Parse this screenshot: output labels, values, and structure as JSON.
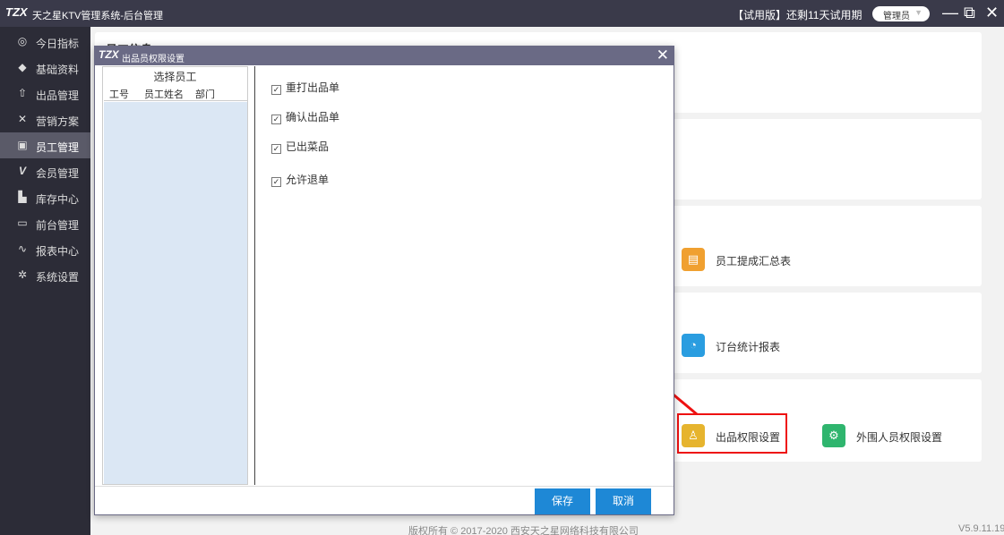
{
  "titlebar": {
    "logo": "TZX",
    "title": "天之星KTV管理系统-后台管理",
    "trial": "【试用版】还剩11天试用期",
    "role": "管理员",
    "role_chevron": "▼",
    "minimize": "—",
    "restore": "⧉",
    "close": "✕"
  },
  "sidebar": {
    "items": [
      {
        "label": "今日指标",
        "icon": "target-icon",
        "glyph": "◎"
      },
      {
        "label": "基础资料",
        "icon": "layers-icon",
        "glyph": "◆"
      },
      {
        "label": "出品管理",
        "icon": "upload-icon",
        "glyph": "⇧"
      },
      {
        "label": "营销方案",
        "icon": "tools-icon",
        "glyph": "✕"
      },
      {
        "label": "员工管理",
        "icon": "employee-icon",
        "glyph": "▣"
      },
      {
        "label": "会员管理",
        "icon": "member-icon",
        "glyph": "V"
      },
      {
        "label": "库存中心",
        "icon": "inventory-icon",
        "glyph": "▙"
      },
      {
        "label": "前台管理",
        "icon": "monitor-icon",
        "glyph": "▭"
      },
      {
        "label": "报表中心",
        "icon": "chart-line-icon",
        "glyph": "∿"
      },
      {
        "label": "系统设置",
        "icon": "gear-icon",
        "glyph": "✲"
      }
    ],
    "active_index": 4
  },
  "main": {
    "panel_title": "员工信息",
    "reports": [
      {
        "label": "员工提成汇总表",
        "icon": "report-icon",
        "color": "#f0a030",
        "glyph": "▤"
      },
      {
        "label": "订台统计报表",
        "icon": "pie-chart-icon",
        "color": "#2a9de0",
        "glyph": "◔"
      },
      {
        "label": "出品权限设置",
        "icon": "product-permission-icon",
        "color": "#e6b42e",
        "glyph": "♙"
      },
      {
        "label": "外围人员权限设置",
        "icon": "external-permission-icon",
        "color": "#2fb56e",
        "glyph": "⚙"
      }
    ]
  },
  "dialog": {
    "logo": "TZX",
    "title": "出品员权限设置",
    "close": "✕",
    "employee_pane_title": "选择员工",
    "columns": [
      "工号",
      "员工姓名",
      "部门"
    ],
    "permissions": [
      {
        "label": "重打出品单",
        "checked": true
      },
      {
        "label": "确认出品单",
        "checked": true
      },
      {
        "label": "已出菜品",
        "checked": true
      },
      {
        "label": "允许退单",
        "checked": true
      }
    ],
    "checkmark": "✓",
    "save_label": "保存",
    "cancel_label": "取消"
  },
  "footer": {
    "copyright": "版权所有 © 2017-2020 西安天之星网络科技有限公司",
    "version": "V5.9.11.19"
  },
  "colors": {
    "accent": "#1e88d6",
    "highlight": "#e11111",
    "sidebar_bg": "#2c2c37",
    "dialog_title_bg": "#6a6a85"
  }
}
